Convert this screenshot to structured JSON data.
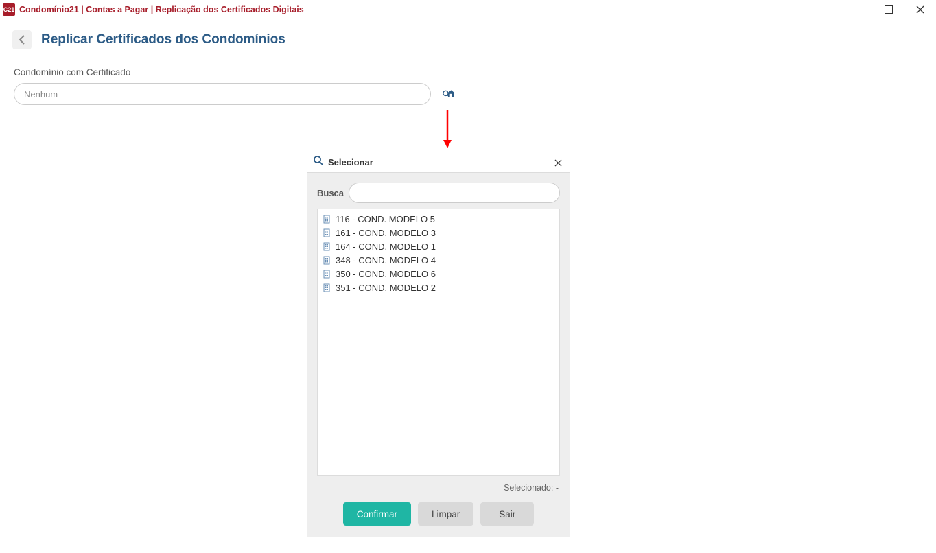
{
  "window": {
    "title": "Condomínio21 | Contas a Pagar | Replicação dos Certificados Digitais",
    "app_icon_text": "C21"
  },
  "page": {
    "title": "Replicar Certificados dos Condomínios"
  },
  "form": {
    "certificate_label": "Condomínio com Certificado",
    "certificate_value": "Nenhum"
  },
  "dialog": {
    "title": "Selecionar",
    "search_label": "Busca",
    "search_value": "",
    "items": [
      {
        "label": "116 - COND. MODELO 5"
      },
      {
        "label": "161 - COND. MODELO 3"
      },
      {
        "label": "164 - COND. MODELO 1"
      },
      {
        "label": "348 - COND. MODELO 4"
      },
      {
        "label": "350 - COND. MODELO 6"
      },
      {
        "label": "351 - COND. MODELO 2"
      }
    ],
    "selected_label": "Selecionado: -",
    "confirm_label": "Confirmar",
    "clear_label": "Limpar",
    "exit_label": "Sair"
  }
}
